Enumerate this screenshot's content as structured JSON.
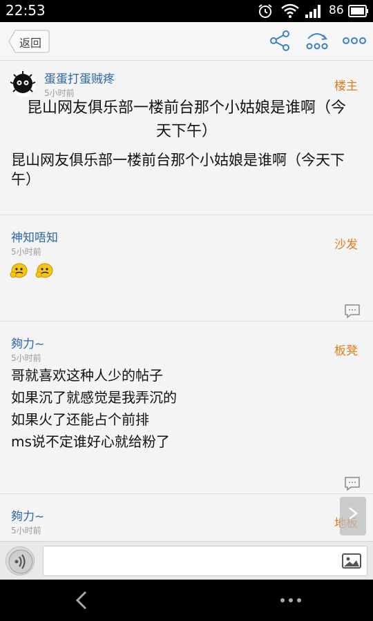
{
  "status_bar": {
    "time": "22:53",
    "battery": "86"
  },
  "toolbar": {
    "back_label": "返回",
    "icons": [
      "share-icon",
      "refresh-icon",
      "more-icon"
    ]
  },
  "post": {
    "author": "蛋蛋打蛋贼疼",
    "time": "5小时前",
    "floor": "楼主",
    "title": "昆山网友俱乐部一楼前台那个小姑娘是谁啊（今天下午）",
    "body": "昆山网友俱乐部一楼前台那个小姑娘是谁啊（今天下午）"
  },
  "replies": [
    {
      "author": "神知唔知",
      "time": "5小时前",
      "floor": "沙发",
      "emojis": [
        "emoji-face",
        "emoji-face"
      ]
    },
    {
      "author": "夠力~",
      "time": "5小时前",
      "floor": "板凳",
      "lines": [
        "哥就喜欢这种人少的帖子",
        "如果沉了就感觉是我弄沉的",
        "如果火了还能占个前排",
        "ms说不定谁好心就给粉了"
      ]
    },
    {
      "author": "夠力~",
      "time": "5小时前",
      "floor": "地板"
    }
  ],
  "input": {
    "placeholder": ""
  },
  "colors": {
    "author": "#2a66a8",
    "floor": "#e07c1a",
    "icon_blue": "#3b7fc4"
  }
}
